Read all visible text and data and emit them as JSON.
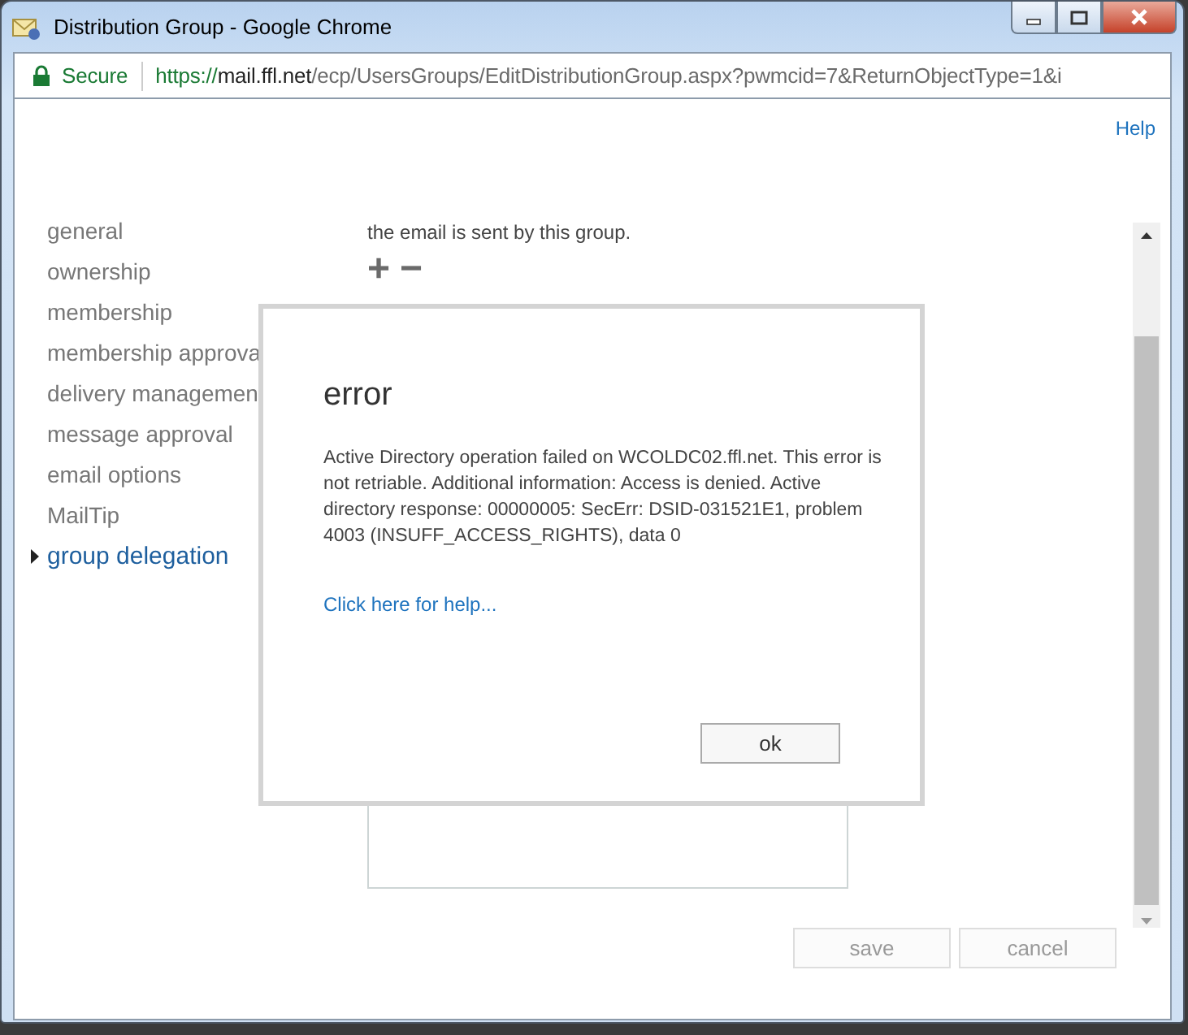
{
  "window": {
    "title": "Distribution Group - Google Chrome"
  },
  "address_bar": {
    "security": "Secure",
    "url_scheme": "https://",
    "url_host": "mail.ffl.net",
    "url_path": "/ecp/UsersGroups/EditDistributionGroup.aspx?pwmcid=7&ReturnObjectType=1&i"
  },
  "help_link": "Help",
  "sidebar": {
    "items": [
      {
        "label": "general",
        "selected": false
      },
      {
        "label": "ownership",
        "selected": false
      },
      {
        "label": "membership",
        "selected": false
      },
      {
        "label": "membership approva",
        "selected": false
      },
      {
        "label": "delivery managemen",
        "selected": false
      },
      {
        "label": "message approval",
        "selected": false
      },
      {
        "label": "email options",
        "selected": false
      },
      {
        "label": "MailTip",
        "selected": false
      },
      {
        "label": "group delegation",
        "selected": true
      }
    ]
  },
  "main": {
    "description": "the email is sent by this group.",
    "add_icon": "+",
    "remove_icon": "−"
  },
  "footer": {
    "buttons": [
      {
        "label": "save",
        "disabled": true
      },
      {
        "label": "cancel",
        "disabled": true
      }
    ]
  },
  "dialog": {
    "title": "error",
    "message": "Active Directory operation failed on WCOLDC02.ffl.net. This error is not retriable. Additional information: Access is denied. Active directory response: 00000005: SecErr: DSID-031521E1, problem 4003 (INSUFF_ACCESS_RIGHTS), data 0",
    "help_link": "Click here for help...",
    "button": "ok"
  }
}
